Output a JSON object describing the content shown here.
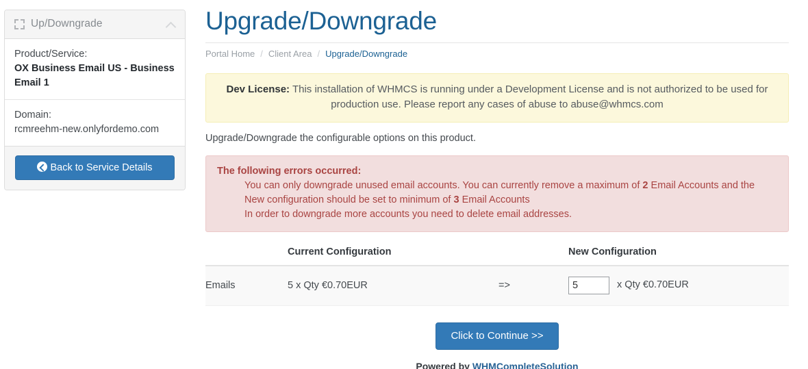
{
  "sidebar": {
    "panel_title": "Up/Downgrade",
    "expand_icon": "expand-icon",
    "collapse_icon": "chevron-up-icon",
    "sections": [
      {
        "label": "Product/Service:",
        "value": "OX Business Email US - Business Email 1"
      },
      {
        "label": "Domain:",
        "value": "rcmreehm-new.onlyfordemo.com"
      }
    ],
    "back_button": {
      "label": "Back to Service Details",
      "icon": "arrow-circle-left-icon"
    }
  },
  "main": {
    "page_title": "Upgrade/Downgrade",
    "breadcrumb": {
      "item1": "Portal Home",
      "sep1": "/",
      "item2": "Client Area",
      "sep2": "/",
      "item3": "Upgrade/Downgrade"
    },
    "dev_alert": {
      "label": "Dev License:",
      "text": " This installation of WHMCS is running under a Development License and is not authorized to be used for production use. Please report any cases of abuse to abuse@whmcs.com"
    },
    "lead": "Upgrade/Downgrade the configurable options on this product.",
    "error_alert": {
      "heading": "The following errors occurred:",
      "line1_a": "You can only downgrade unused email accounts. You can currently remove a maximum of ",
      "line1_b": "2",
      "line1_c": " Email Accounts and the New configuration should be set to minimum of ",
      "line1_d": "3",
      "line1_e": " Email Accounts",
      "line2": "In order to downgrade more accounts you need to delete email addresses."
    },
    "table": {
      "headers": {
        "blank": "",
        "current": "Current Configuration",
        "arrow_head": "",
        "new": "New Configuration"
      },
      "rows": [
        {
          "name": "Emails",
          "current": "5 x Qty €0.70EUR",
          "arrow": "=>",
          "new_value": "5",
          "new_suffix": "x Qty €0.70EUR"
        }
      ]
    },
    "continue_button": "Click to Continue >>",
    "footer": {
      "prefix": "Powered by ",
      "link": "WHMCompleteSolution"
    }
  },
  "colors": {
    "primary": "#337ab7",
    "title": "#1c6193",
    "warning_bg": "#fcf8dc",
    "danger_bg": "#f2dede",
    "danger_text": "#a94442",
    "link": "#2a6496"
  }
}
